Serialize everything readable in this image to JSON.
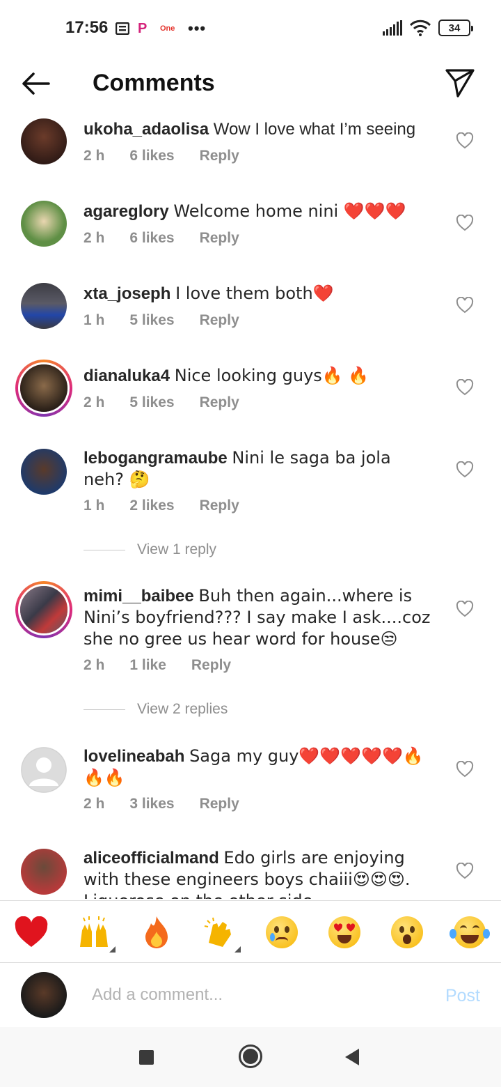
{
  "status_bar": {
    "time": "17:56",
    "notif_one": "One",
    "notif_p": "P",
    "dots": "•••",
    "battery": "34"
  },
  "header": {
    "title": "Comments"
  },
  "comments": [
    {
      "username": "ukoha_adaolisa",
      "text": "Wow I love what I’m seeing",
      "time": "2 h",
      "likes": "6 likes",
      "reply": "Reply",
      "avatar_color": "#2b1a1a"
    },
    {
      "username": "agareglory",
      "text": "Welcome home nini ❤️❤️❤️",
      "time": "2 h",
      "likes": "6 likes",
      "reply": "Reply",
      "avatar_color": "#5f8f45"
    },
    {
      "username": "xta_joseph",
      "text": "I love them both❤️",
      "time": "1 h",
      "likes": "5 likes",
      "reply": "Reply",
      "avatar_color": "#4a4a52"
    },
    {
      "username": "dianaluka4",
      "text": "Nice looking guys🔥 🔥",
      "time": "2 h",
      "likes": "5 likes",
      "reply": "Reply",
      "avatar_color": "#c9b79b"
    },
    {
      "username": "lebogangramaube",
      "text": "Nini le saga ba jola neh? 🤔",
      "time": "1 h",
      "likes": "2 likes",
      "reply": "Reply",
      "avatar_color": "#2a3f5f",
      "view_replies": "View 1 reply"
    },
    {
      "username": "mimi__baibee",
      "text": "Buh then again...where is Nini’s boyfriend??? I say make I ask....coz she no gree us hear word for house😒",
      "time": "2 h",
      "likes": "1 like",
      "reply": "Reply",
      "avatar_color": "#6a5a66",
      "view_replies": "View 2 replies"
    },
    {
      "username": "lovelineabah",
      "text": "Saga my guy❤️❤️❤️❤️❤️🔥 🔥🔥",
      "time": "2 h",
      "likes": "3 likes",
      "reply": "Reply",
      "avatar_color": "#d8d8d8"
    },
    {
      "username": "aliceofficialmand",
      "text": "Edo girls are enjoying with these engineers boys  chaiii😍😍😍. Liquorose on the other side",
      "time": "",
      "likes": "",
      "reply": "",
      "avatar_color": "#b73a3a"
    }
  ],
  "emoji_bar": [
    "❤️",
    "🙌",
    "🔥",
    "👏",
    "😢",
    "😍",
    "😮",
    "😂"
  ],
  "comment_input": {
    "placeholder": "Add a comment...",
    "post_label": "Post"
  },
  "icons": {
    "back": "arrow-left-icon",
    "send": "paper-plane-icon",
    "like": "heart-outline-icon"
  }
}
